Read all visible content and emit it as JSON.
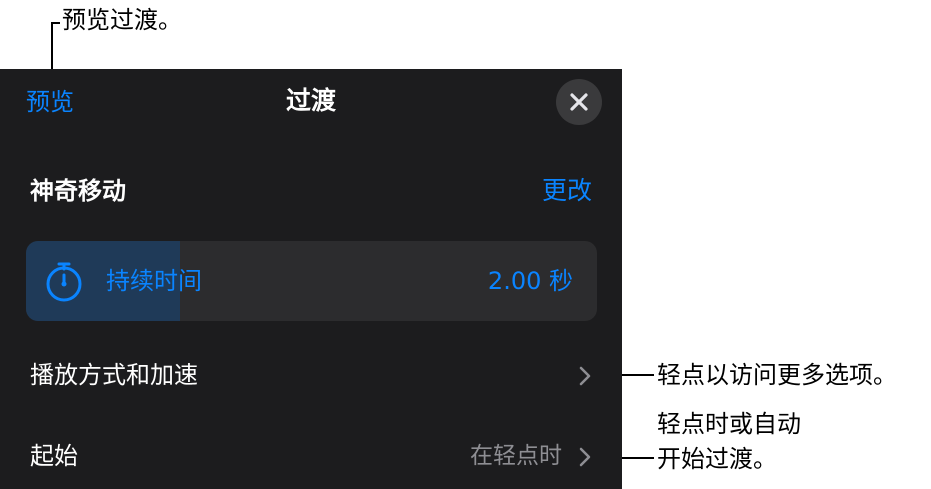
{
  "callouts": {
    "preview": "预览过渡。",
    "more_options": "轻点以访问更多选项。",
    "start_line1": "轻点时或自动",
    "start_line2": "开始过渡。"
  },
  "header": {
    "preview_label": "预览",
    "title": "过渡",
    "close_icon": "close-icon"
  },
  "effect": {
    "name": "神奇移动",
    "change_label": "更改"
  },
  "duration": {
    "label": "持续时间",
    "value": "2.00 秒",
    "progress": 0.27,
    "icon": "stopwatch-icon"
  },
  "rows": {
    "delivery_label": "播放方式和加速",
    "start_label": "起始",
    "start_value": "在轻点时"
  },
  "colors": {
    "accent": "#0a84ff",
    "panel_bg": "#1c1c1e",
    "row_bg": "#2c2c2e",
    "secondary_text": "#8e8e93"
  }
}
